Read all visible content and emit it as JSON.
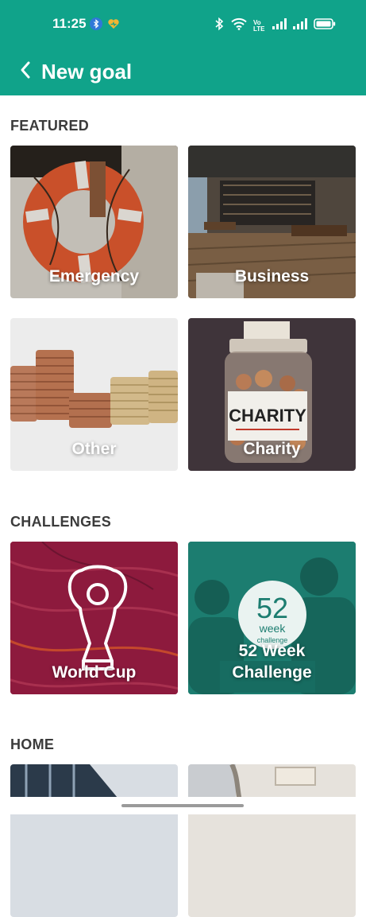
{
  "status_bar": {
    "time": "11:25",
    "network_label": "Vo LTE",
    "icons": [
      "bluetooth-badge-icon",
      "heart-badge-icon",
      "bluetooth-icon",
      "wifi-icon",
      "signal-icon",
      "signal-icon",
      "battery-icon"
    ]
  },
  "header": {
    "title": "New goal",
    "back_icon": "chevron-left-icon"
  },
  "sections": {
    "featured": {
      "title": "FEATURED",
      "cards": [
        {
          "label": "Emergency"
        },
        {
          "label": "Business"
        },
        {
          "label": "Other"
        },
        {
          "label": "Charity"
        }
      ],
      "charity_jar_text": "CHARITY"
    },
    "challenges": {
      "title": "CHALLENGES",
      "cards": [
        {
          "label": "World Cup"
        },
        {
          "label": "52 Week Challenge",
          "badge_number": "52",
          "badge_text1": "week",
          "badge_text2": "challenge"
        }
      ]
    },
    "home": {
      "title": "HOME"
    }
  },
  "colors": {
    "brand": "#10a38a",
    "world_cup": "#8d1a3d",
    "challenge_teal": "#1c7d70"
  }
}
